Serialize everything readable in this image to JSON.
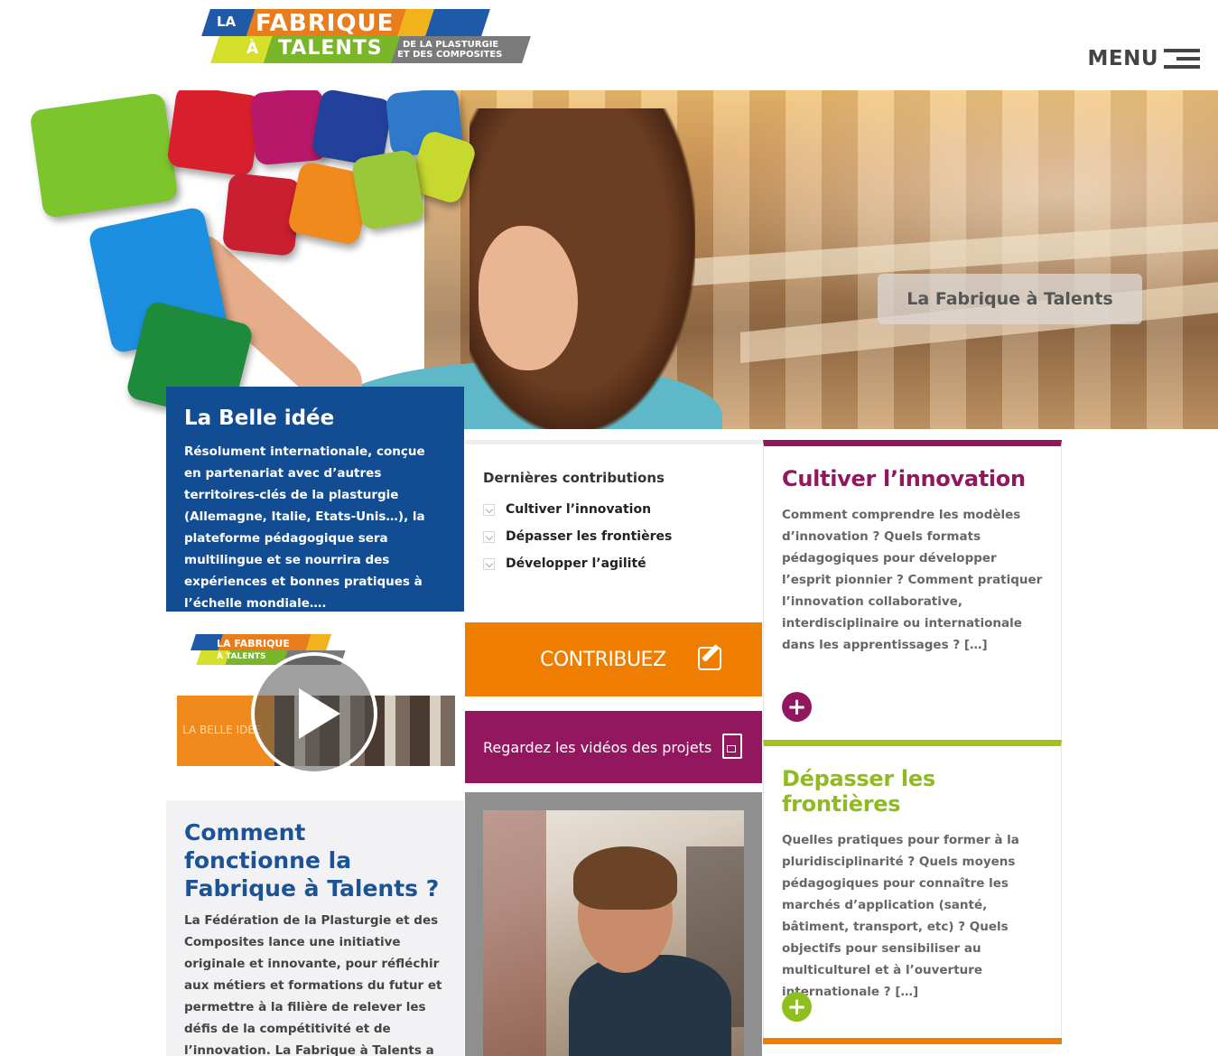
{
  "header": {
    "logo": {
      "line1_la": "LA",
      "line1_fabrique": "FABRIQUE",
      "line2_a": "À",
      "line2_talents": "TALENTS",
      "subtitle1": "DE LA PLASTURGIE",
      "subtitle2": "ET DES COMPOSITES"
    },
    "menu_label": "MENU"
  },
  "hero": {
    "caption": "La Fabrique à Talents"
  },
  "belle_idee": {
    "title": "La Belle idée",
    "text": "Résolument internationale, conçue en partenariat avec d’autres territoires-clés de la plasturgie (Allemagne, Italie, Etats-Unis…), la plateforme pédagogique sera multilingue et se nourrira des expériences et bonnes pratiques à l’échelle mondiale…."
  },
  "video": {
    "logo_line1": "LA FABRIQUE",
    "logo_line2": "À TALENTS",
    "strip_text": "LA BELLE IDÉE"
  },
  "how": {
    "title": "Comment fonctionne la Fabrique à Talents ?",
    "text": "La Fédération de la Plasturgie et des Composites lance une initiative originale et innovante, pour réfléchir aux métiers et formations du futur et permettre à la filière de relever les défis de la compétitivité et de l’innovation. La Fabrique à Talents a pour objectif de répondre aux questions : quelles"
  },
  "contributions": {
    "title": "Dernières contributions",
    "items": [
      {
        "label": "Cultiver l’innovation"
      },
      {
        "label": "Dépasser les frontières"
      },
      {
        "label": "Développer l’agilité"
      }
    ]
  },
  "buttons": {
    "contribuez": "CONTRIBUEZ",
    "videos": "Regardez les vidéos des projets"
  },
  "cards": [
    {
      "title": "Cultiver l’innovation",
      "text": "Comment comprendre les modèles d’innovation ? Quels formats pédagogiques pour développer l’esprit pionnier ? Comment pratiquer l’innovation collaborative, interdisciplinaire ou internationale dans les apprentissages ? […]",
      "color": "#93175f"
    },
    {
      "title": "Dépasser les frontières",
      "text": "Quelles pratiques pour former à la pluridisciplinarité ? Quels moyens pédagogiques pour connaître les marchés d’application (santé, bâtiment, transport, etc) ? Quels objectifs pour sensibiliser au multiculturel et à l’ouverture internationale ? […]",
      "color": "#8fbb1f"
    }
  ],
  "icons": {
    "plus": "+",
    "burger": "hamburger-icon",
    "edit": "edit-icon",
    "video_file": "video-file-icon",
    "play": "play-icon",
    "chevron": "chevron-down-icon"
  },
  "colors": {
    "navy": "#124d94",
    "orange": "#ef7d00",
    "purple": "#93175f",
    "lime": "#8fbb1f"
  }
}
